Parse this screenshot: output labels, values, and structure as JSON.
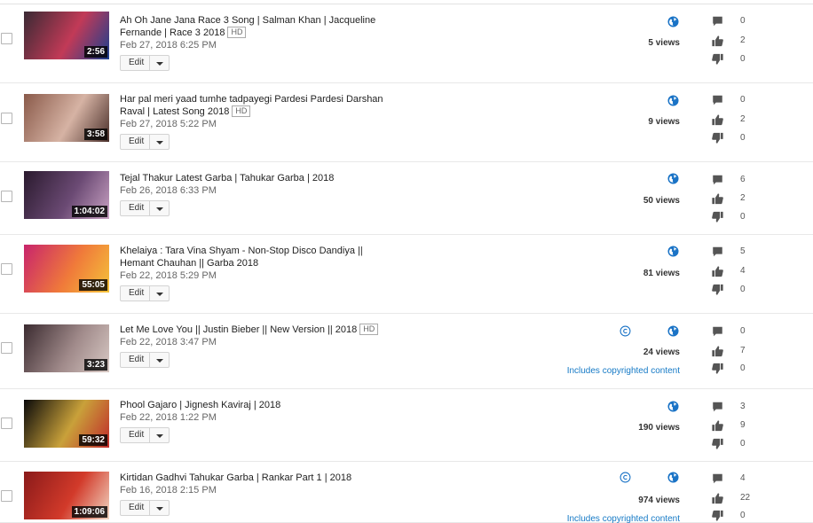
{
  "videos": [
    {
      "title": "Ah Oh Jane Jana Race 3 Song | Salman Khan | Jacqueline Fernande | Race 3 2018",
      "hd": "HD",
      "date": "Feb 27, 2018 6:25 PM",
      "duration": "2:56",
      "edit_label": "Edit",
      "views": "5 views",
      "copyrighted": false,
      "copyright_note": "",
      "comments": "0",
      "likes": "2",
      "dislikes": "0",
      "thumb_colors": [
        "#3a2a34",
        "#c23a57",
        "#1a3f8f"
      ]
    },
    {
      "title": "Har pal meri yaad tumhe tadpayegi Pardesi Pardesi Darshan Raval | Latest Song 2018",
      "hd": "HD",
      "date": "Feb 27, 2018 5:22 PM",
      "duration": "3:58",
      "edit_label": "Edit",
      "views": "9 views",
      "copyrighted": false,
      "copyright_note": "",
      "comments": "0",
      "likes": "2",
      "dislikes": "0",
      "thumb_colors": [
        "#8a5a4a",
        "#d6b3a4",
        "#4a2f2a"
      ]
    },
    {
      "title": "Tejal Thakur Latest Garba | Tahukar Garba | 2018",
      "hd": "",
      "date": "Feb 26, 2018 6:33 PM",
      "duration": "1:04:02",
      "edit_label": "Edit",
      "views": "50 views",
      "copyrighted": false,
      "copyright_note": "",
      "comments": "6",
      "likes": "2",
      "dislikes": "0",
      "thumb_colors": [
        "#2a1a2e",
        "#6b4a74",
        "#c9a2c3"
      ]
    },
    {
      "title": "Khelaiya : Tara Vina Shyam - Non-Stop Disco Dandiya || Hemant Chauhan || Garba 2018",
      "hd": "",
      "date": "Feb 22, 2018 5:29 PM",
      "duration": "55:05",
      "edit_label": "Edit",
      "views": "81 views",
      "copyrighted": false,
      "copyright_note": "",
      "comments": "5",
      "likes": "4",
      "dislikes": "0",
      "thumb_colors": [
        "#c8246c",
        "#f07a3a",
        "#f4c33a"
      ]
    },
    {
      "title": "Let Me Love You || Justin Bieber || New Version || 2018",
      "hd": "HD",
      "date": "Feb 22, 2018 3:47 PM",
      "duration": "3:23",
      "edit_label": "Edit",
      "views": "24 views",
      "copyrighted": true,
      "copyright_note": "Includes copyrighted content",
      "comments": "0",
      "likes": "7",
      "dislikes": "0",
      "thumb_colors": [
        "#3b2b30",
        "#a08a8a",
        "#d8c9c4"
      ]
    },
    {
      "title": "Phool Gajaro | Jignesh Kaviraj | 2018",
      "hd": "",
      "date": "Feb 22, 2018 1:22 PM",
      "duration": "59:32",
      "edit_label": "Edit",
      "views": "190 views",
      "copyrighted": false,
      "copyright_note": "",
      "comments": "3",
      "likes": "9",
      "dislikes": "0",
      "thumb_colors": [
        "#0a0a0a",
        "#c9a13a",
        "#c02a2a"
      ]
    },
    {
      "title": "Kirtidan Gadhvi Tahukar Garba | Rankar Part 1 | 2018",
      "hd": "",
      "date": "Feb 16, 2018 2:15 PM",
      "duration": "1:09:06",
      "edit_label": "Edit",
      "views": "974 views",
      "copyrighted": true,
      "copyright_note": "Includes copyrighted content",
      "comments": "4",
      "likes": "22",
      "dislikes": "0",
      "thumb_colors": [
        "#8a1a1a",
        "#d23a2a",
        "#f1d6c2"
      ]
    }
  ],
  "icons": {
    "visibility": "globe-icon",
    "copyright": "copyright-icon",
    "comments": "comment-icon",
    "likes": "thumbs-up-icon",
    "dislikes": "thumbs-down-icon"
  },
  "colors": {
    "globe": "#1a73c6",
    "link": "#167ac6",
    "stat_icon": "#555555"
  }
}
